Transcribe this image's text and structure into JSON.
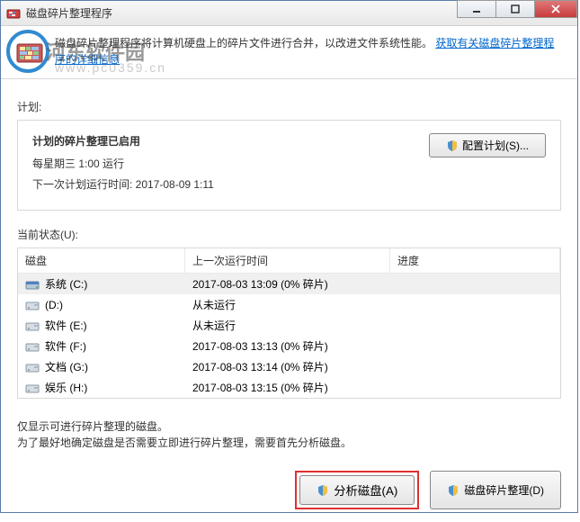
{
  "window": {
    "title": "磁盘碎片整理程序"
  },
  "header": {
    "text_before_link": "磁盘碎片整理程序将计算机硬盘上的碎片文件进行合并，以改进文件系统性能。",
    "link_text": "获取有关磁盘碎片整理程序的详细信息"
  },
  "schedule": {
    "label": "计划:",
    "enabled_text": "计划的碎片整理已启用",
    "frequency": "每星期三  1:00 运行",
    "next_run": "下一次计划运行时间: 2017-08-09 1:11",
    "config_button": "配置计划(S)..."
  },
  "status": {
    "label": "当前状态(U):",
    "columns": {
      "disk": "磁盘",
      "lastrun": "上一次运行时间",
      "progress": "进度"
    },
    "rows": [
      {
        "name": "系统 (C:)",
        "lastrun": "2017-08-03 13:09 (0% 碎片)",
        "icon": "system"
      },
      {
        "name": "(D:)",
        "lastrun": "从未运行",
        "icon": "drive"
      },
      {
        "name": "软件 (E:)",
        "lastrun": "从未运行",
        "icon": "drive"
      },
      {
        "name": "软件 (F:)",
        "lastrun": "2017-08-03 13:13 (0% 碎片)",
        "icon": "drive"
      },
      {
        "name": "文档 (G:)",
        "lastrun": "2017-08-03 13:14 (0% 碎片)",
        "icon": "drive"
      },
      {
        "name": "娱乐 (H:)",
        "lastrun": "2017-08-03 13:15 (0% 碎片)",
        "icon": "drive"
      }
    ]
  },
  "hints": {
    "line1": "仅显示可进行碎片整理的磁盘。",
    "line2": "为了最好地确定磁盘是否需要立即进行碎片整理，需要首先分析磁盘。"
  },
  "buttons": {
    "analyze": "分析磁盘(A)",
    "defrag": "磁盘碎片整理(D)"
  },
  "watermark": {
    "text": "河东软件园",
    "url": "www.pc0359.cn"
  }
}
